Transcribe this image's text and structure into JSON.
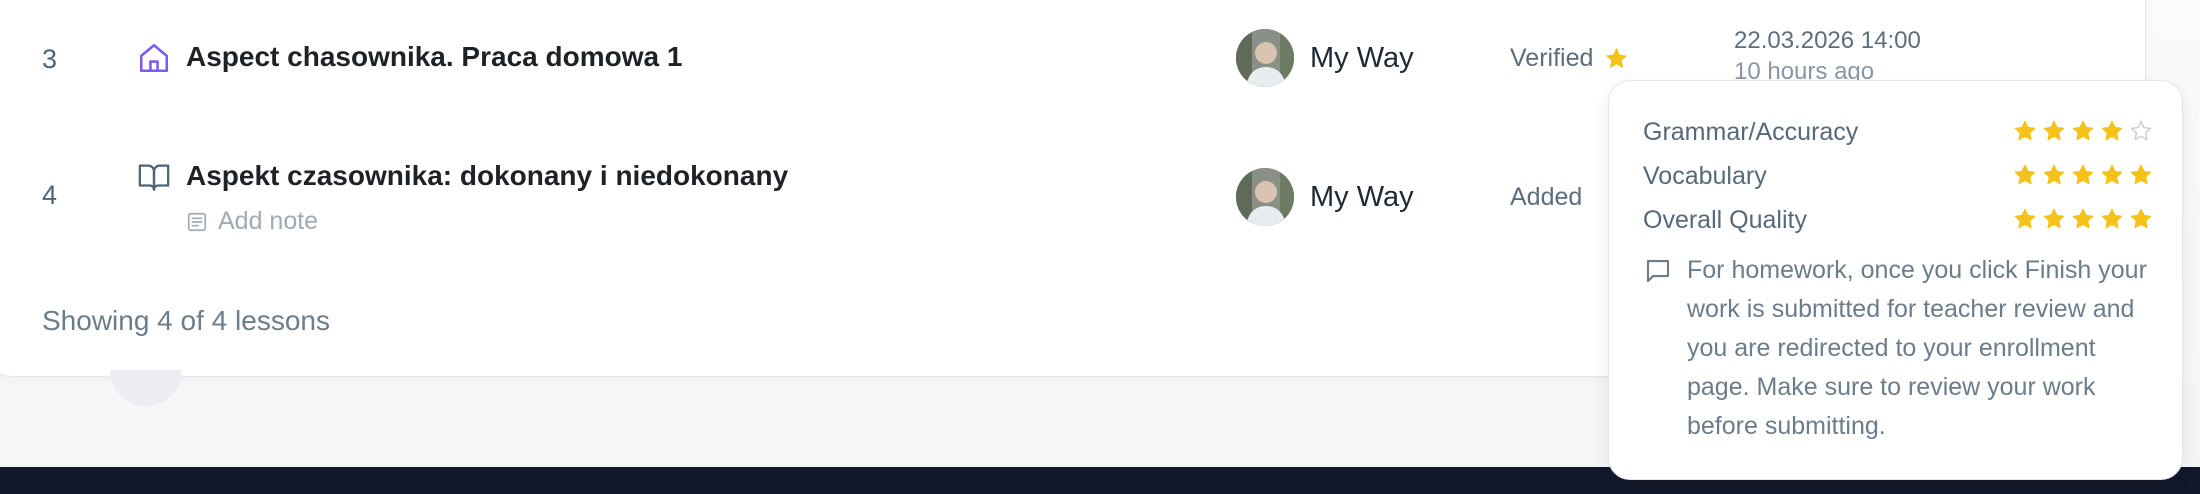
{
  "lessons": [
    {
      "number": "3",
      "icon": "house-icon",
      "title": "Aspect chasownika. Praca domowa 1",
      "teacher": "My Way",
      "status": "Verified",
      "status_icon": "star-icon",
      "date": "22.03.2026 14:00",
      "date_relative": "10 hours ago"
    },
    {
      "number": "4",
      "icon": "book-open-icon",
      "title": "Aspekt czasownika: dokonany i niedokonany",
      "note_label": "Add note",
      "teacher": "My Way",
      "status": "Added"
    }
  ],
  "pagination": {
    "showing": "Showing 4 of 4 lessons"
  },
  "review_tooltip": {
    "criteria": [
      {
        "label": "Grammar/Accuracy",
        "rating": 4,
        "max": 5
      },
      {
        "label": "Vocabulary",
        "rating": 5,
        "max": 5
      },
      {
        "label": "Overall Quality",
        "rating": 5,
        "max": 5
      }
    ],
    "comment_icon": "message-square-icon",
    "comment": "For homework, once you click Finish your work is submitted for teacher review and you are redirected to your enrollment page. Make sure to review your work before submitting."
  },
  "colors": {
    "accent_purple": "#7c5cf0",
    "star_gold": "#f5c318",
    "footer_navy": "#121829"
  }
}
